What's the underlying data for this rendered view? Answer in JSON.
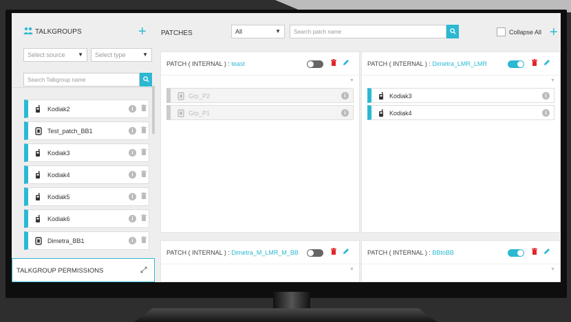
{
  "talkgroups": {
    "title": "TALKGROUPS",
    "add": "+",
    "source_placeholder": "Select source",
    "type_placeholder": "Select type",
    "search_placeholder": "Search Talkgroup name",
    "items": [
      {
        "label": "Kodiak2",
        "icon": "radio"
      },
      {
        "label": "Test_patch_BB1",
        "icon": "patch"
      },
      {
        "label": "Kodiak3",
        "icon": "radio"
      },
      {
        "label": "Kodiak4",
        "icon": "radio"
      },
      {
        "label": "Kodiak5",
        "icon": "radio"
      },
      {
        "label": "Kodiak6",
        "icon": "radio"
      },
      {
        "label": "Dimetra_BB1",
        "icon": "patch"
      }
    ]
  },
  "permissions": {
    "title": "TALKGROUP PERMISSIONS"
  },
  "patches_bar": {
    "title": "PATCHES",
    "filter": "All",
    "search_placeholder": "Search patch name",
    "collapse_label": "Collapse All",
    "add": "+"
  },
  "patches": [
    {
      "prefix": "PATCH ( INTERNAL ) : ",
      "name": "teast",
      "enabled": false,
      "members": [
        {
          "label": "Grp_P2",
          "icon": "patch",
          "disabled": true
        },
        {
          "label": "Grp_P1",
          "icon": "patch",
          "disabled": true
        }
      ]
    },
    {
      "prefix": "PATCH ( INTERNAL ) : ",
      "name": "Dimetra_LMR_LMR",
      "enabled": true,
      "members": [
        {
          "label": "Kodiak3",
          "icon": "radio",
          "disabled": false
        },
        {
          "label": "Kodiak4",
          "icon": "radio",
          "disabled": false
        }
      ]
    },
    {
      "prefix": "PATCH ( INTERNAL ) : ",
      "name": "Dimetra_M_LMR_M_BB",
      "enabled": false,
      "members": []
    },
    {
      "prefix": "PATCH ( INTERNAL ) : ",
      "name": "BBtoBB",
      "enabled": true,
      "members": []
    }
  ],
  "colors": {
    "accent": "#2bb8d3",
    "danger": "#e0262a",
    "disabled_bar": "#cccccc"
  }
}
